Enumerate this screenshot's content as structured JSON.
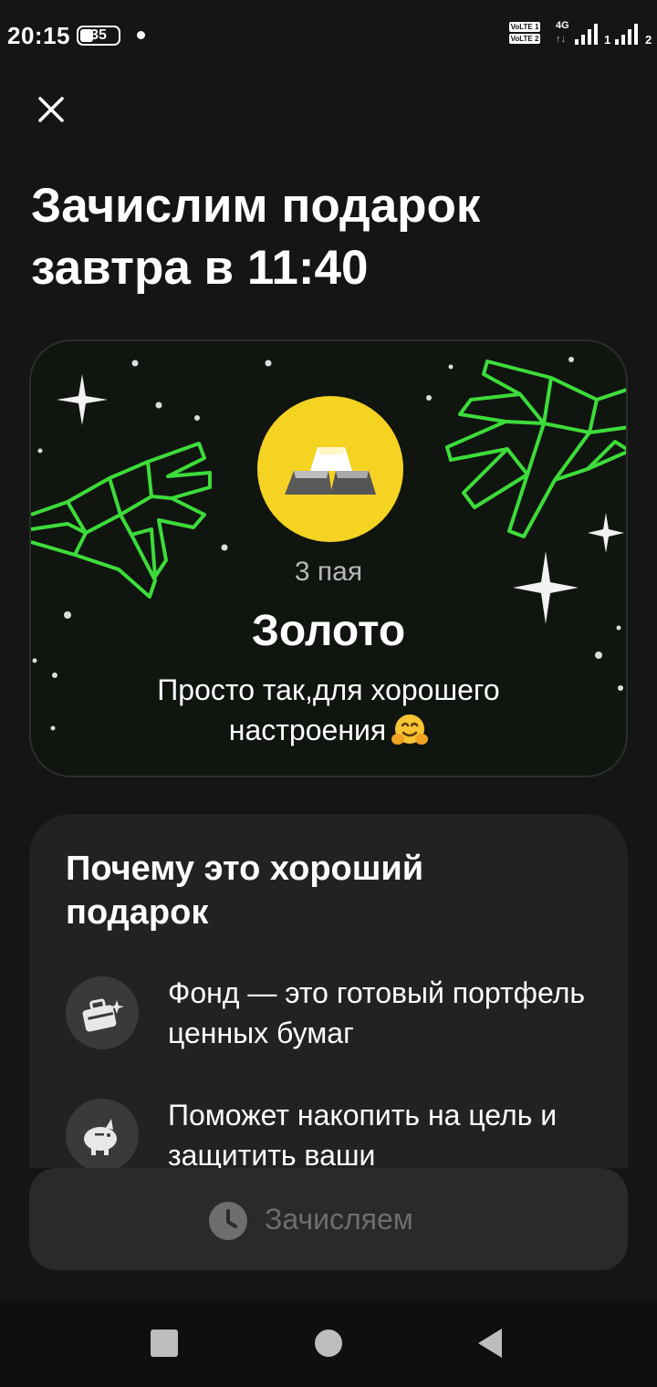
{
  "status_bar": {
    "time": "20:15",
    "battery": "35",
    "network": "4G",
    "sim1": "1",
    "sim2": "2",
    "volte1": "VoLTE 1",
    "volte2": "VoLTE 2"
  },
  "header": {
    "title": "Зачислим подарок завтра в 11:40"
  },
  "gift_card": {
    "date": "3 пая",
    "name": "Золото",
    "message": "Просто так,для хорошего настроения",
    "emoji": "hugging-face-emoji",
    "accent_color": "#3ddc3a",
    "coin_color": "#f5d323"
  },
  "why_card": {
    "title": "Почему это хороший подарок",
    "items": [
      {
        "icon": "briefcase-icon",
        "text": "Фонд — это готовый портфель ценных бумаг"
      },
      {
        "icon": "piggy-bank-icon",
        "text": "Поможет накопить на цель и защитить ваши"
      }
    ]
  },
  "action": {
    "label": "Зачисляем",
    "icon": "clock-icon"
  },
  "nav": {
    "recent": "recent-apps-icon",
    "home": "home-icon",
    "back": "back-icon"
  }
}
